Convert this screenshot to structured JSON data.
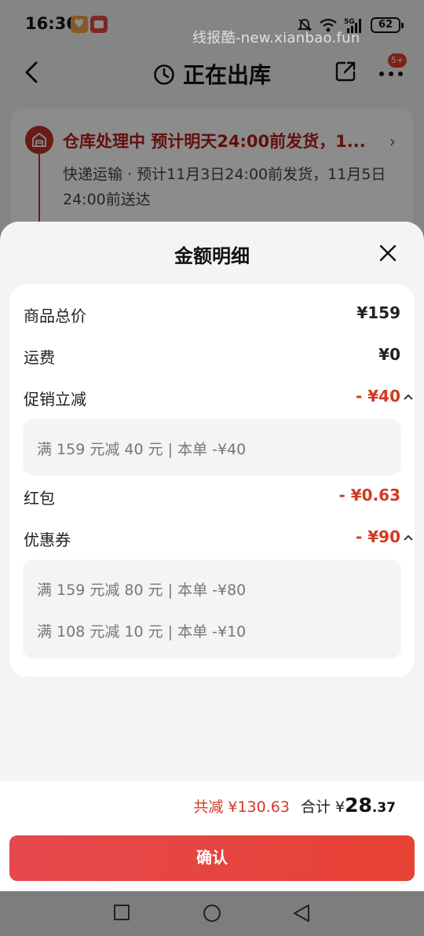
{
  "status_bar": {
    "time": "16:36",
    "watermark": "线报酷-new.xianbao.fun",
    "battery": "62",
    "icons": [
      "heart-app-icon",
      "shopping-app-icon",
      "mute-icon",
      "wifi-icon",
      "signal-5g-icon",
      "battery-icon"
    ]
  },
  "nav": {
    "title": "正在出库",
    "badge": "5+",
    "icons": [
      "back-icon",
      "clock-icon",
      "share-icon",
      "more-icon"
    ]
  },
  "order": {
    "status": "仓库处理中  预计明天24:00前发货，1...",
    "detail": "快递运输 · 预计11月3日24:00前发货，11月5日24:00前送达",
    "icons": [
      "warehouse-icon",
      "chevron-right-icon"
    ]
  },
  "sheet": {
    "title": "金额明细",
    "rows": {
      "goods_total": {
        "label": "商品总价",
        "value": "¥159"
      },
      "shipping": {
        "label": "运费",
        "value": "¥0"
      },
      "promotion": {
        "label": "促销立减",
        "value": "- ¥40"
      },
      "red_packet": {
        "label": "红包",
        "value": "- ¥0.63"
      },
      "coupon": {
        "label": "优惠券",
        "value": "- ¥90"
      }
    },
    "promotion_items": [
      "满 159 元减 40 元 | 本单 -¥40"
    ],
    "coupon_items": [
      "满 159 元减 80 元 | 本单 -¥80",
      "满 108 元减 10 元 | 本单 -¥10"
    ]
  },
  "summary": {
    "saved": "共减 ¥130.63",
    "total_label": "合计 ¥",
    "total_int": "28",
    "total_dec": ".37",
    "confirm_label": "确认"
  },
  "colors": {
    "accent_red": "#d23a22",
    "button_red": "#e5484d",
    "status_red": "#b41e16"
  }
}
